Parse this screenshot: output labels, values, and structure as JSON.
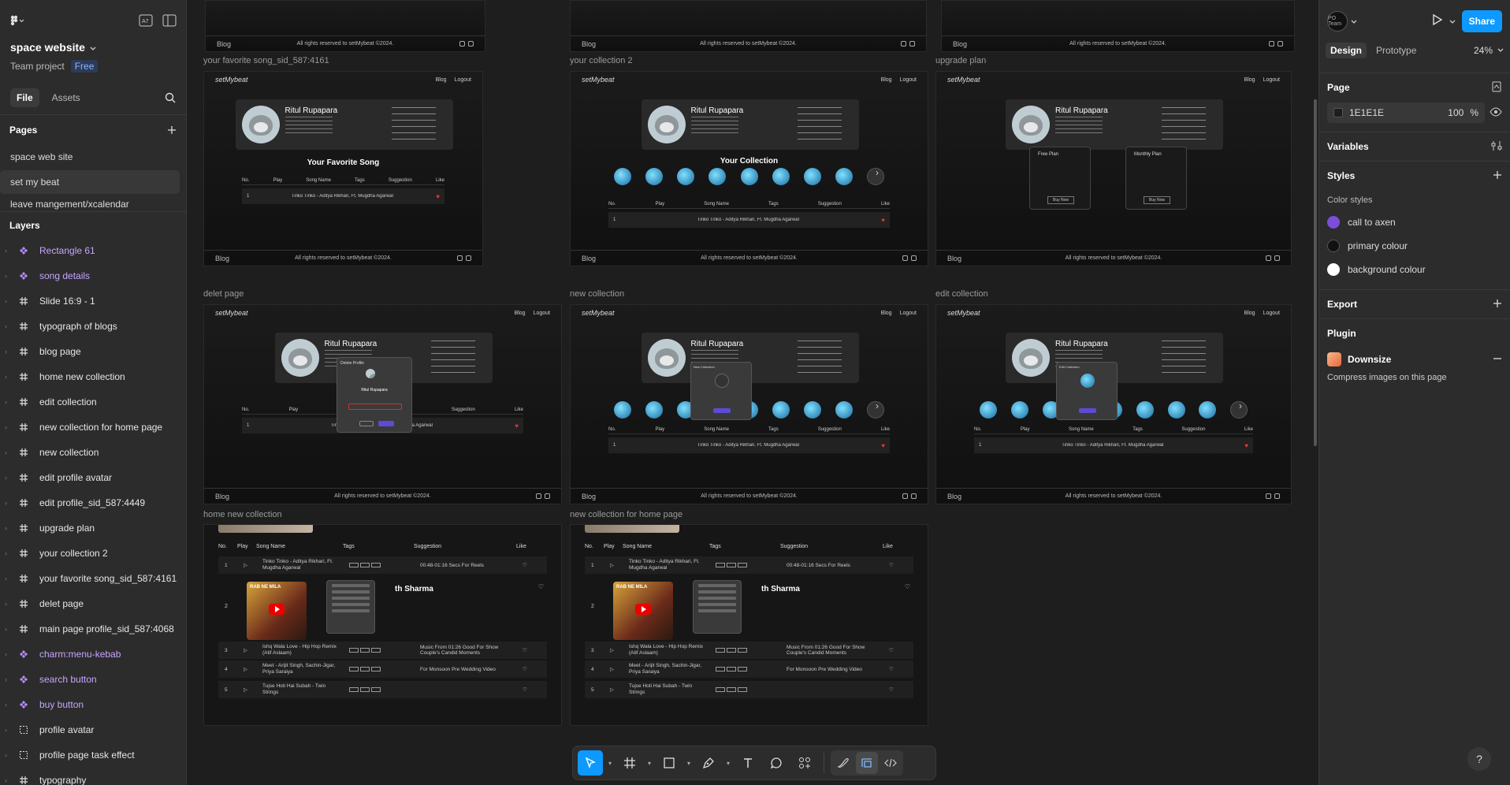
{
  "file": {
    "name": "space website",
    "team": "Team project",
    "plan_badge": "Free",
    "left_tabs": [
      "File",
      "Assets"
    ],
    "pages_heading": "Pages",
    "pages": [
      "space web site",
      "set my beat",
      "leave mangement/xcalendar"
    ],
    "selected_page": 1,
    "layers_heading": "Layers",
    "layers": [
      {
        "name": "Rectangle 61",
        "kind": "component"
      },
      {
        "name": "song details",
        "kind": "component"
      },
      {
        "name": "Slide 16:9 - 1",
        "kind": "frame"
      },
      {
        "name": "typograph of blogs",
        "kind": "frame"
      },
      {
        "name": "blog page",
        "kind": "frame"
      },
      {
        "name": "home new collection",
        "kind": "frame"
      },
      {
        "name": "edit collection",
        "kind": "frame"
      },
      {
        "name": "new collection for home page",
        "kind": "frame"
      },
      {
        "name": "new collection",
        "kind": "frame"
      },
      {
        "name": "edit profile avatar",
        "kind": "frame"
      },
      {
        "name": "edit profile_sid_587:4449",
        "kind": "frame"
      },
      {
        "name": "upgrade plan",
        "kind": "frame"
      },
      {
        "name": "your collection 2",
        "kind": "frame"
      },
      {
        "name": "your favorite song_sid_587:4161",
        "kind": "frame"
      },
      {
        "name": "delet page",
        "kind": "frame"
      },
      {
        "name": "main page profile_sid_587:4068",
        "kind": "frame"
      },
      {
        "name": "charm:menu-kebab",
        "kind": "component"
      },
      {
        "name": "search button",
        "kind": "component"
      },
      {
        "name": "buy button",
        "kind": "component"
      },
      {
        "name": "profile avatar",
        "kind": "group"
      },
      {
        "name": "profile page task effect",
        "kind": "group"
      },
      {
        "name": "typography",
        "kind": "frame"
      }
    ]
  },
  "canvas": {
    "frames": [
      {
        "label": "your favorite song_sid_587:4161",
        "type": "favorite",
        "title": "Your Favorite Song"
      },
      {
        "label": "your collection 2",
        "type": "collection",
        "title": "Your Collection"
      },
      {
        "label": "upgrade plan",
        "type": "plan",
        "title": ""
      },
      {
        "label": "delet page",
        "type": "delete",
        "title": ""
      },
      {
        "label": "new collection",
        "type": "newcol",
        "title": ""
      },
      {
        "label": "edit collection",
        "type": "editcol",
        "title": ""
      }
    ],
    "big_frames": [
      {
        "label": "home new collection"
      },
      {
        "label": "new collection for home page"
      }
    ],
    "site": {
      "logo": "setMybeat",
      "nav": [
        "Blog",
        "Logout"
      ],
      "footer_left": "Blog",
      "footer_center": "All rights reserved to setMybeat ©2024.",
      "profile_name": "Ritul Rupapara",
      "table_headers": [
        "No.",
        "Play",
        "Song Name",
        "Tags",
        "Suggestion",
        "Like"
      ],
      "table_row": {
        "no": "1",
        "song": "Tinko Tinko - Aditya Rikhari, Ft. Mugdha Agarwal"
      },
      "plans": [
        "Free Plan",
        "Monthly Plan"
      ],
      "buy_now": "Buy Now",
      "delete_modal_title": "Delete Profile",
      "new_collection_modal_title": "New Collection",
      "edit_collection_modal_title": "Edit Collection"
    },
    "big_table": {
      "headers": [
        "No.",
        "Play",
        "Song Name",
        "Tags",
        "Suggestion",
        "Like"
      ],
      "rows": [
        {
          "no": "1",
          "song": "Tinko Tinko - Aditya Rikhari, Ft. Mugdha Agarwal",
          "suggestion": "00:48-01:16 Secs For Reels"
        },
        {
          "no": "2",
          "song": "",
          "suggestion": ""
        },
        {
          "no": "3",
          "song": "Ishq Wala Love - Hip Hop Remix (Atif Aslaam)",
          "suggestion": "Music From 01:26 Good For Show Couple's Candid Moments"
        },
        {
          "no": "4",
          "song": "Meet - Arijit Singh, Sachin-Jigar, Priya Saraiya",
          "suggestion": "For Monsoon Pre Wedding Video"
        },
        {
          "no": "5",
          "song": "Tujse Hoti Hai Subah - Twin Strings",
          "suggestion": ""
        }
      ],
      "video_caption": "RAB NE MILA",
      "artist": "Sharma",
      "artist_prefix": "th"
    }
  },
  "right": {
    "avatar_text": "PO Team",
    "share_label": "Share",
    "tabs": [
      "Design",
      "Prototype"
    ],
    "zoom": "24%",
    "page_heading": "Page",
    "page_color": "1E1E1E",
    "page_opacity": "100",
    "page_opacity_unit": "%",
    "variables_heading": "Variables",
    "styles_heading": "Styles",
    "color_styles_heading": "Color styles",
    "color_styles": [
      {
        "name": "call to axen",
        "color": "#7c4ddb"
      },
      {
        "name": "primary colour",
        "color": "#111111"
      },
      {
        "name": "background colour",
        "color": "#ffffff"
      }
    ],
    "export_heading": "Export",
    "plugin_heading": "Plugin",
    "plugin_name": "Downsize",
    "plugin_action": "Compress images on this page",
    "help": "?"
  }
}
